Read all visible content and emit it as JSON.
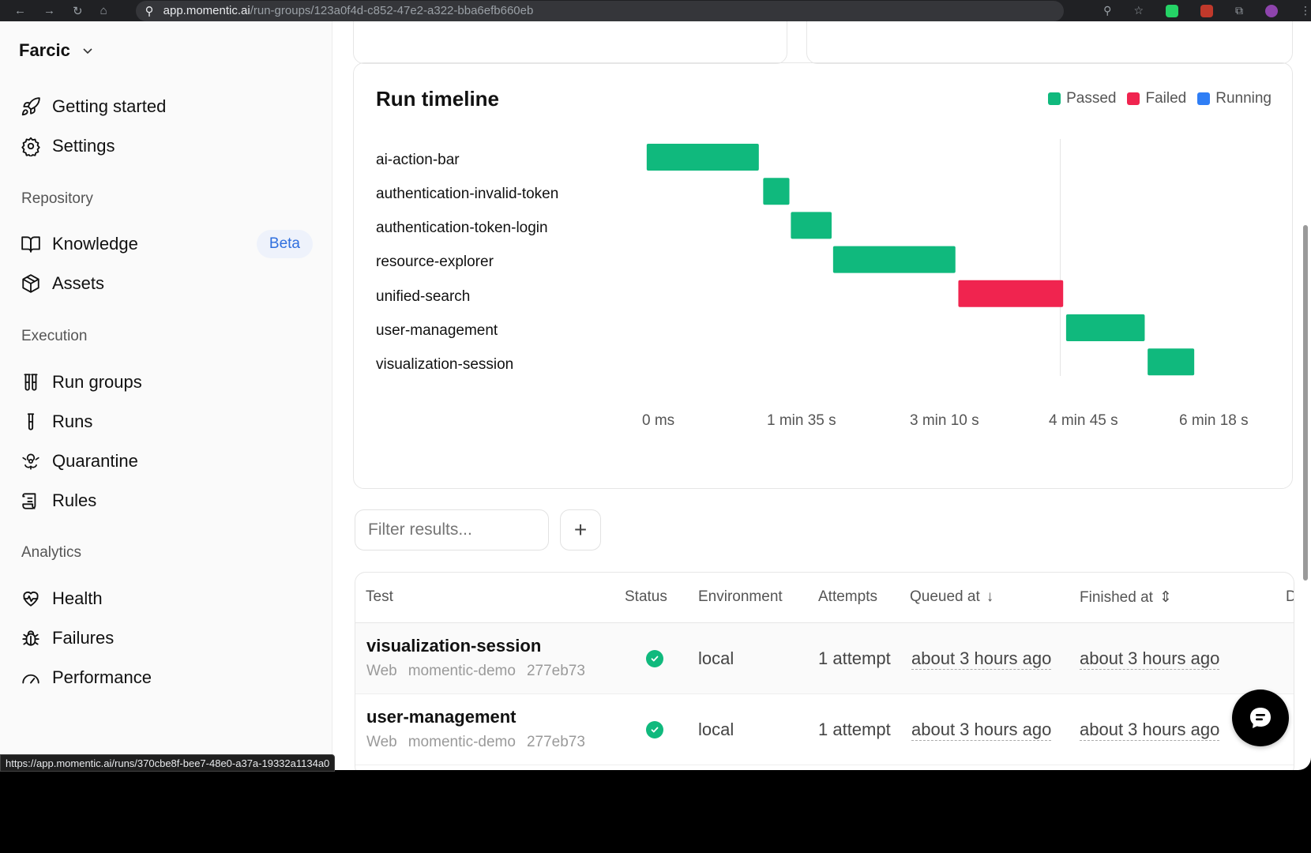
{
  "browser": {
    "url_host": "app.momentic.ai",
    "url_path": "/run-groups/123a0f4d-c852-47e2-a322-bba6efb660eb",
    "status_link": "https://app.momentic.ai/runs/370cbe8f-bee7-48e0-a37a-19332a1134a0"
  },
  "sidebar": {
    "org": "Farcic",
    "top_items": [
      {
        "label": "Getting started",
        "icon": "rocket-icon"
      },
      {
        "label": "Settings",
        "icon": "gear-icon"
      }
    ],
    "sections": [
      {
        "title": "Repository",
        "items": [
          {
            "label": "Knowledge",
            "icon": "book-icon",
            "badge": "Beta"
          },
          {
            "label": "Assets",
            "icon": "box-icon"
          }
        ]
      },
      {
        "title": "Execution",
        "items": [
          {
            "label": "Run groups",
            "icon": "test-tubes-icon"
          },
          {
            "label": "Runs",
            "icon": "test-tube-icon"
          },
          {
            "label": "Quarantine",
            "icon": "biohazard-icon"
          },
          {
            "label": "Rules",
            "icon": "scroll-icon"
          }
        ]
      },
      {
        "title": "Analytics",
        "items": [
          {
            "label": "Health",
            "icon": "heart-pulse-icon"
          },
          {
            "label": "Failures",
            "icon": "bug-icon"
          },
          {
            "label": "Performance",
            "icon": "gauge-icon"
          }
        ]
      }
    ]
  },
  "timeline": {
    "title": "Run timeline",
    "legend": [
      {
        "label": "Passed",
        "color": "#10b97d"
      },
      {
        "label": "Failed",
        "color": "#f0244f"
      },
      {
        "label": "Running",
        "color": "#2f7ef5"
      }
    ]
  },
  "chart_data": {
    "type": "bar",
    "orientation": "horizontal-gantt",
    "title": "Run timeline",
    "x_unit": "seconds",
    "xlim": [
      0,
      378
    ],
    "x_ticks": [
      {
        "value": 0,
        "label": "0 ms"
      },
      {
        "value": 95,
        "label": "1 min 35 s"
      },
      {
        "value": 190,
        "label": "3 min 10 s"
      },
      {
        "value": 285,
        "label": "4 min 45 s"
      },
      {
        "value": 378,
        "label": "6 min 18 s"
      }
    ],
    "categories": [
      "ai-action-bar",
      "authentication-invalid-token",
      "authentication-token-login",
      "resource-explorer",
      "unified-search",
      "user-management",
      "visualization-session"
    ],
    "series": [
      {
        "start": 1,
        "end": 78,
        "status": "Passed"
      },
      {
        "start": 81,
        "end": 99,
        "status": "Passed"
      },
      {
        "start": 100,
        "end": 128,
        "status": "Passed"
      },
      {
        "start": 129,
        "end": 213,
        "status": "Passed"
      },
      {
        "start": 215,
        "end": 287,
        "status": "Failed"
      },
      {
        "start": 289,
        "end": 343,
        "status": "Passed"
      },
      {
        "start": 345,
        "end": 377,
        "status": "Passed"
      }
    ],
    "marker_at": 285
  },
  "filter": {
    "placeholder": "Filter results..."
  },
  "table": {
    "headers": [
      "Test",
      "Status",
      "Environment",
      "Attempts",
      "Queued at",
      "Finished at",
      "D"
    ],
    "rows": [
      {
        "name": "visualization-session",
        "platform": "Web",
        "project": "momentic-demo",
        "commit": "277eb73",
        "status": "passed",
        "environment": "local",
        "attempts": "1 attempt",
        "queued": "about 3 hours ago",
        "finished": "about 3 hours ago"
      },
      {
        "name": "user-management",
        "platform": "Web",
        "project": "momentic-demo",
        "commit": "277eb73",
        "status": "passed",
        "environment": "local",
        "attempts": "1 attempt",
        "queued": "about 3 hours ago",
        "finished": "about 3 hours ago"
      }
    ]
  }
}
